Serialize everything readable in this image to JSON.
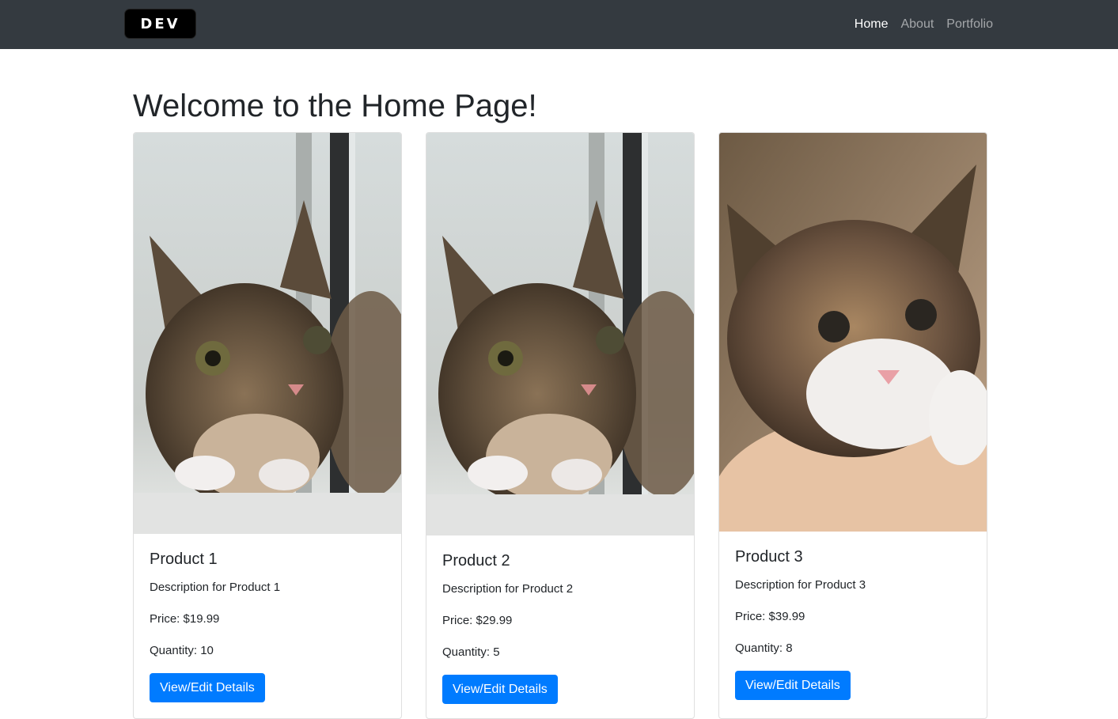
{
  "navbar": {
    "brand": "DEV",
    "links": [
      {
        "label": "Home",
        "active": true
      },
      {
        "label": "About",
        "active": false
      },
      {
        "label": "Portfolio",
        "active": false
      }
    ]
  },
  "page": {
    "title": "Welcome to the Home Page!"
  },
  "products": [
    {
      "name": "Product 1",
      "description": "Description for Product 1",
      "price": "Price: $19.99",
      "quantity": "Quantity: 10",
      "button": "View/Edit Details",
      "image": "tabby kitten by window"
    },
    {
      "name": "Product 2",
      "description": "Description for Product 2",
      "price": "Price: $29.99",
      "quantity": "Quantity: 5",
      "button": "View/Edit Details",
      "image": "tabby kitten by window"
    },
    {
      "name": "Product 3",
      "description": "Description for Product 3",
      "price": "Price: $39.99",
      "quantity": "Quantity: 8",
      "button": "View/Edit Details",
      "image": "tabby kitten held in hand"
    }
  ],
  "colors": {
    "navbar": "#343a40",
    "primary": "#007bff",
    "text": "#212529"
  }
}
